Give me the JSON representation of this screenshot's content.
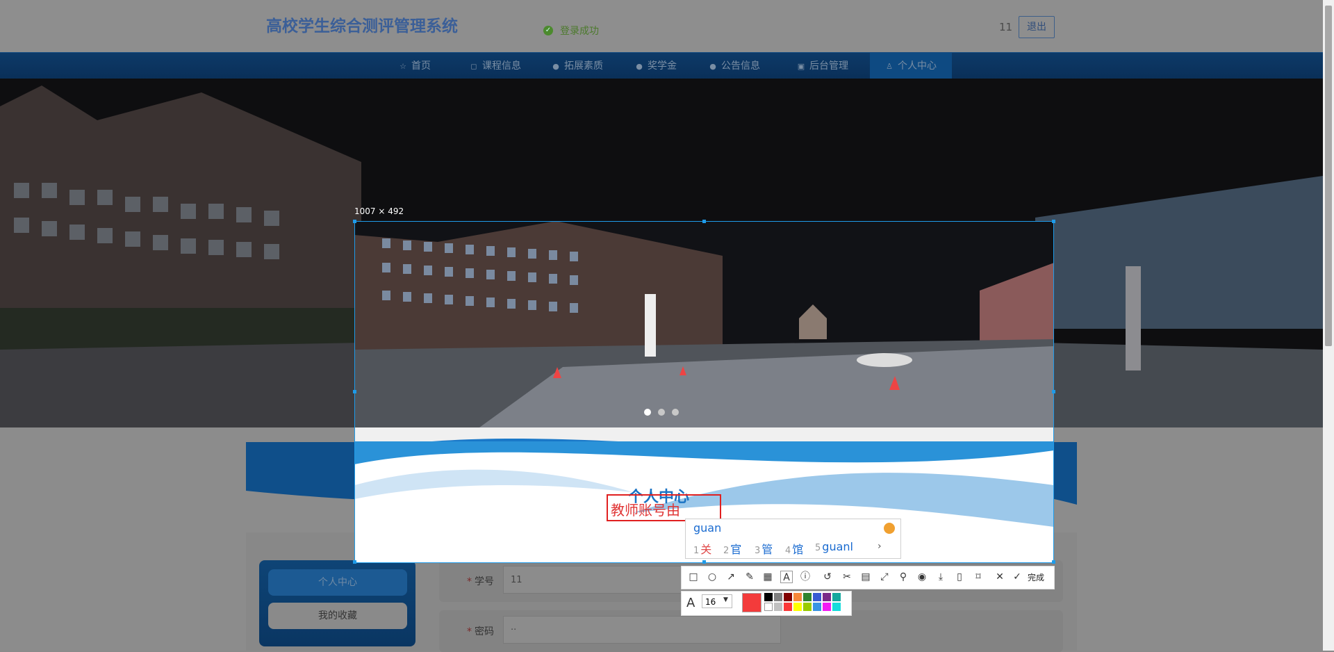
{
  "header": {
    "site_title": "高校学生综合测评管理系统",
    "login_toast": "登录成功",
    "user_id": "11",
    "logout_label": "退出"
  },
  "nav": {
    "items": [
      {
        "label": "首页",
        "icon": "home-icon"
      },
      {
        "label": "课程信息",
        "icon": "bag-icon"
      },
      {
        "label": "拓展素质",
        "icon": "info-icon"
      },
      {
        "label": "奖学金",
        "icon": "info-icon"
      },
      {
        "label": "公告信息",
        "icon": "info-icon"
      },
      {
        "label": "后台管理",
        "icon": "briefcase-icon"
      },
      {
        "label": "个人中心",
        "icon": "user-icon",
        "active": true
      }
    ]
  },
  "banner": {
    "carousel_dots": 3,
    "active_dot": 1
  },
  "personal_center": {
    "title": "个人中心",
    "side_menu": [
      "个人中心",
      "我的收藏"
    ],
    "fields": [
      {
        "label": "学号",
        "required": true,
        "value": "11"
      },
      {
        "label": "密码",
        "required": true,
        "value": "··"
      }
    ]
  },
  "capture": {
    "size_label": "1007 × 492",
    "text_annotation": "教师账号由",
    "ime": {
      "input": "guan",
      "candidates": [
        {
          "num": "1",
          "text": "关"
        },
        {
          "num": "2",
          "text": "官"
        },
        {
          "num": "3",
          "text": "管"
        },
        {
          "num": "4",
          "text": "馆"
        },
        {
          "num": "5",
          "text": "guanl"
        }
      ]
    },
    "toolbar": {
      "tools": [
        "rectangle-icon",
        "ellipse-icon",
        "arrow-icon",
        "pen-icon",
        "mosaic-icon",
        "text-icon",
        "serial-number-icon",
        "undo-icon",
        "screenshot-edit-icon",
        "ocr-icon",
        "long-screenshot-icon",
        "pin-icon",
        "record-icon",
        "download-icon",
        "save-icon",
        "bookmark-icon",
        "close-icon"
      ],
      "done_label": "完成"
    },
    "style": {
      "font_size": "16",
      "current_color": "#f33b3b",
      "palette": [
        "#000000",
        "#808080",
        "#800000",
        "#f7883a",
        "#308430",
        "#385ad3",
        "#7a2b89",
        "#13a89e",
        "#ffffff",
        "#c0c0c0",
        "#fb3838",
        "#ffff00",
        "#99cc00",
        "#3894e4",
        "#f31bf3",
        "#16dcdc"
      ]
    }
  }
}
